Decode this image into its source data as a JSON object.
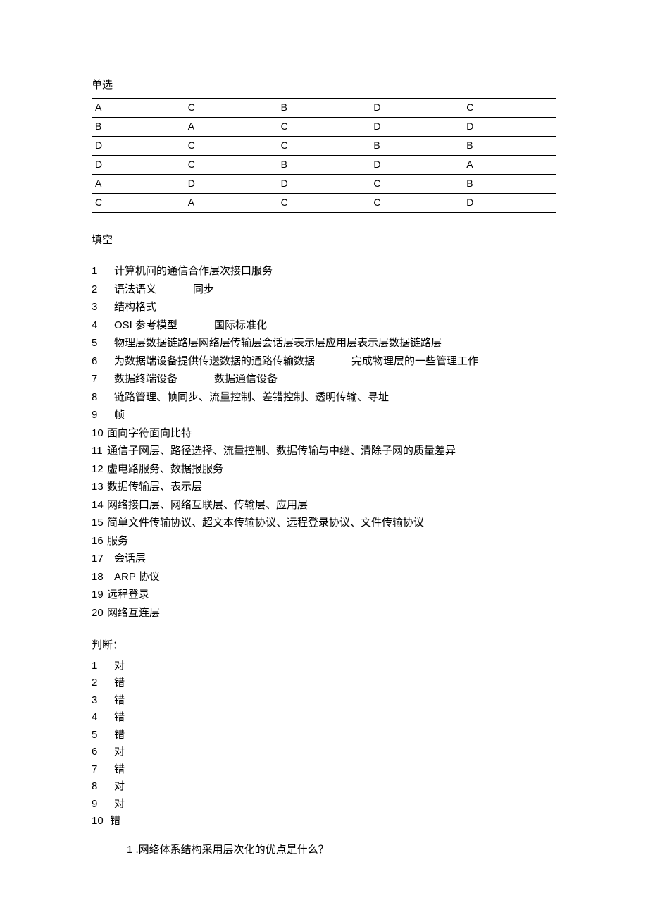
{
  "headings": {
    "single_choice": "单选",
    "fill_blank": "填空",
    "judge": "判断：",
    "question1": "1 .网络体系结构采用层次化的优点是什么？"
  },
  "single_choice": {
    "rows": [
      [
        "A",
        "C",
        "B",
        "D",
        "C"
      ],
      [
        "B",
        "A",
        "C",
        "D",
        "D"
      ],
      [
        "D",
        "C",
        "C",
        "B",
        "B"
      ],
      [
        "D",
        "C",
        "B",
        "D",
        "A"
      ],
      [
        "A",
        "D",
        "D",
        "C",
        "B"
      ],
      [
        "C",
        "A",
        "C",
        "C",
        "D"
      ]
    ]
  },
  "fill": [
    {
      "n": "1",
      "text": "计算机间的通信合作层次接口服务",
      "wide": true
    },
    {
      "n": "2",
      "text": "语法语义",
      "text2": "同步",
      "wide": true,
      "gap": true
    },
    {
      "n": "3",
      "text": "结构格式",
      "wide": true
    },
    {
      "n": "4",
      "text": "OSI 参考模型",
      "text2": "国际标准化",
      "wide": true,
      "gap": true
    },
    {
      "n": "5",
      "text": "物理层数据链路层网络层传输层会话层表示层应用层表示层数据链路层",
      "wide": true
    },
    {
      "n": "6",
      "text": "为数据端设备提供传送数据的通路传输数据",
      "text2": "完成物理层的一些管理工作",
      "wide": true,
      "gap": true
    },
    {
      "n": "7",
      "text": "数据终端设备",
      "text2": "数据通信设备",
      "wide": true,
      "gap": true
    },
    {
      "n": "8",
      "text": "链路管理、帧同步、流量控制、差错控制、透明传输、寻址",
      "wide": true
    },
    {
      "n": "9",
      "text": "帧",
      "wide": true
    },
    {
      "n": "10",
      "text": "面向字符面向比特"
    },
    {
      "n": "11",
      "text": "通信子网层、路径选择、流量控制、数据传输与中继、清除子网的质量差异"
    },
    {
      "n": "12",
      "text": "虚电路服务、数据报服务"
    },
    {
      "n": "13",
      "text": "数据传输层、表示层"
    },
    {
      "n": "14",
      "text": "网络接口层、网络互联层、传输层、应用层"
    },
    {
      "n": "15",
      "text": "简单文件传输协议、超文本传输协议、远程登录协议、文件传输协议"
    },
    {
      "n": "16",
      "text": "服务"
    },
    {
      "n": "17",
      "text": "会话层",
      "wide": true
    },
    {
      "n": "18",
      "text": "ARP 协议",
      "wide": true
    },
    {
      "n": "19",
      "text": "远程登录"
    },
    {
      "n": "20",
      "text": "网络互连层"
    }
  ],
  "judge": [
    {
      "n": "1",
      "v": "对"
    },
    {
      "n": "2",
      "v": "错"
    },
    {
      "n": "3",
      "v": "错"
    },
    {
      "n": "4",
      "v": "错"
    },
    {
      "n": "5",
      "v": "错"
    },
    {
      "n": "6",
      "v": "对"
    },
    {
      "n": "7",
      "v": "错"
    },
    {
      "n": "8",
      "v": "对"
    },
    {
      "n": "9",
      "v": "对"
    },
    {
      "n": "10",
      "v": "错"
    }
  ]
}
